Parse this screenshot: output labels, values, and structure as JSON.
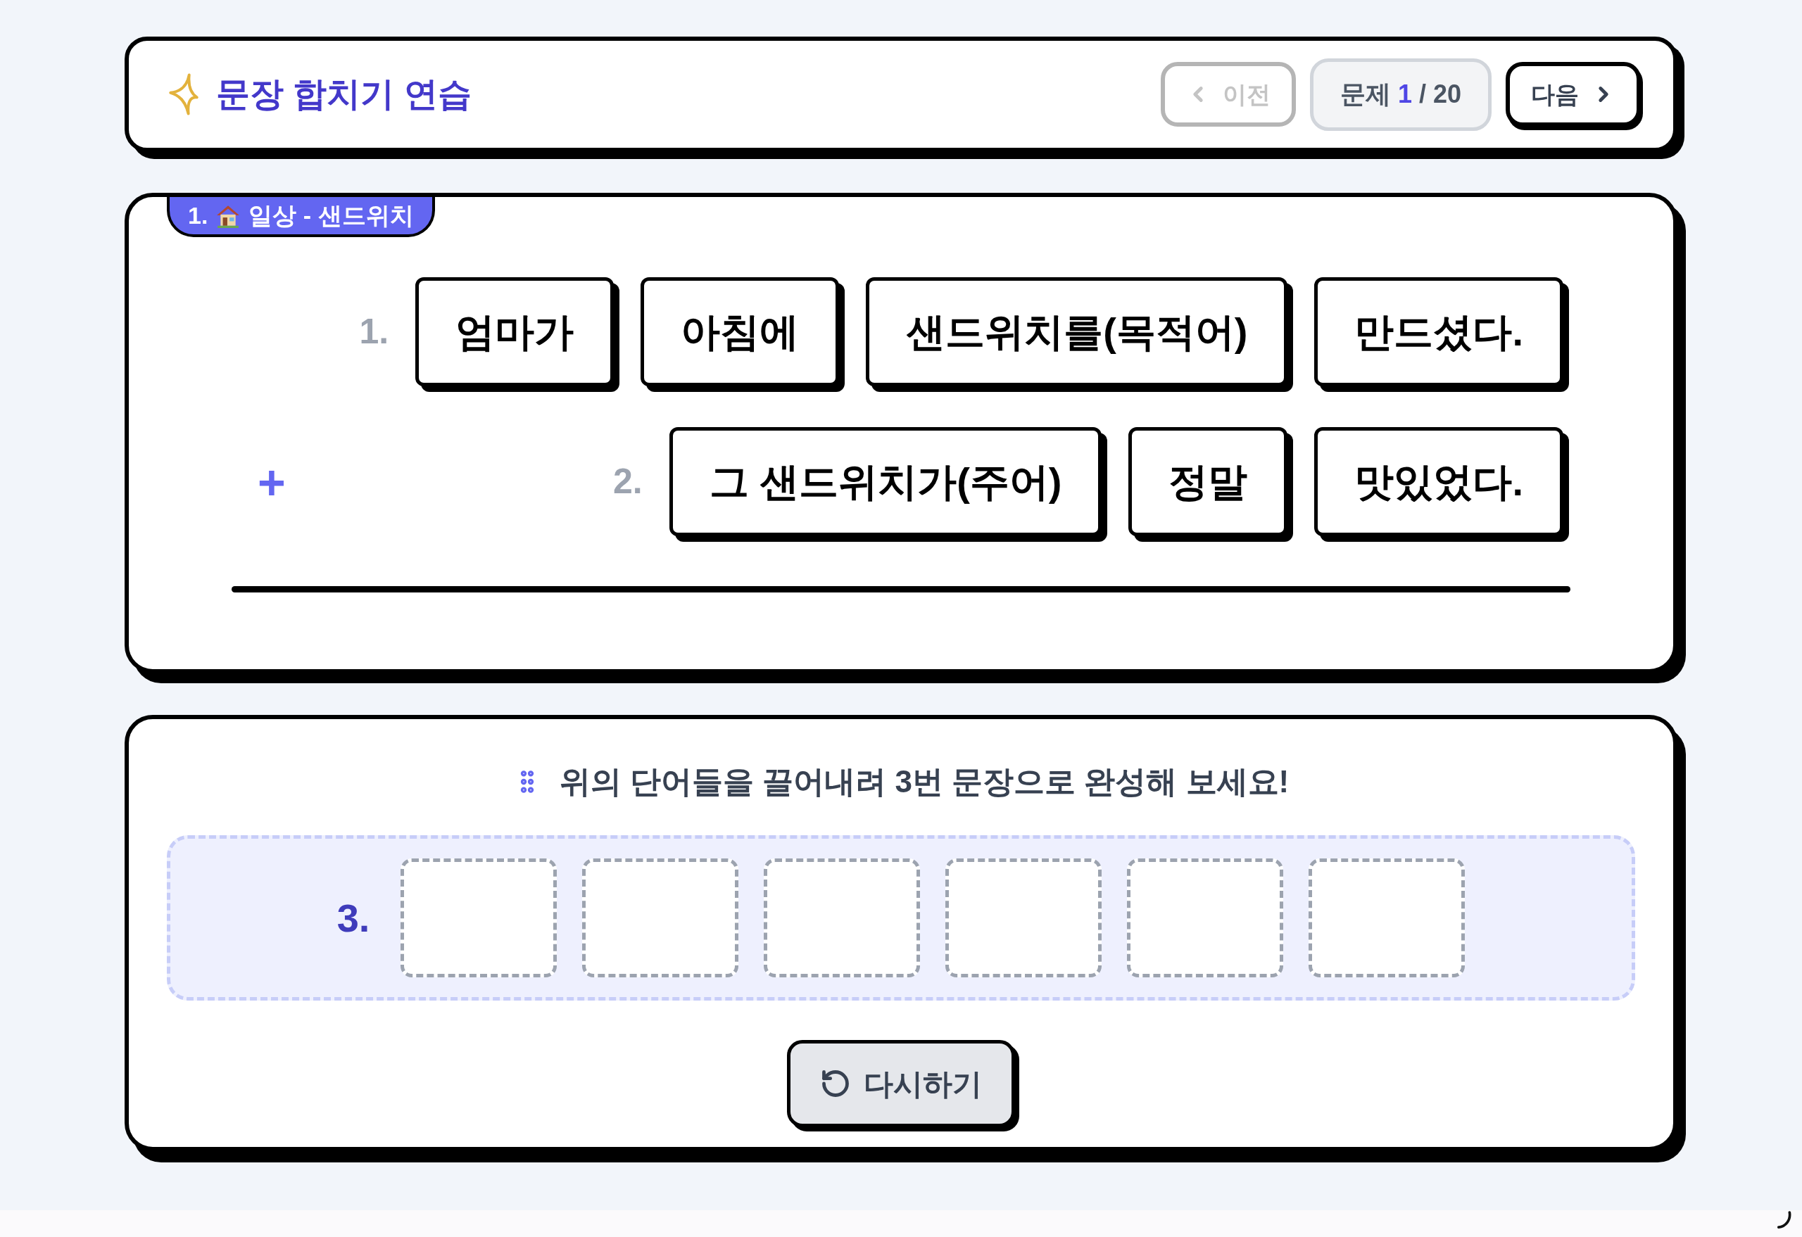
{
  "header": {
    "title": "문장 합치기 연습",
    "prev_button": {
      "label": "이전",
      "disabled": true
    },
    "counter": {
      "label": "문제",
      "current": "1",
      "separator": "/",
      "total": "20"
    },
    "next_button": {
      "label": "다음",
      "disabled": false
    }
  },
  "sentence_card": {
    "badge": {
      "number": "1.",
      "topic": "일상 - 샌드위치"
    },
    "operator": "+",
    "sentences": [
      {
        "label": "1.",
        "words": [
          "엄마가",
          "아침에",
          "샌드위치를(목적어)",
          "만드셨다."
        ]
      },
      {
        "label": "2.",
        "words": [
          "그 샌드위치가(주어)",
          "정말",
          "맛있었다."
        ]
      }
    ]
  },
  "answer_card": {
    "instruction": "위의 단어들을 끌어내려 3번 문장으로 완성해 보세요!",
    "label": "3.",
    "slots": [
      {
        "filled": false
      },
      {
        "filled": false
      },
      {
        "filled": false
      },
      {
        "filled": false
      },
      {
        "filled": false
      },
      {
        "filled": false
      }
    ],
    "retry_button": {
      "label": "다시하기"
    }
  }
}
